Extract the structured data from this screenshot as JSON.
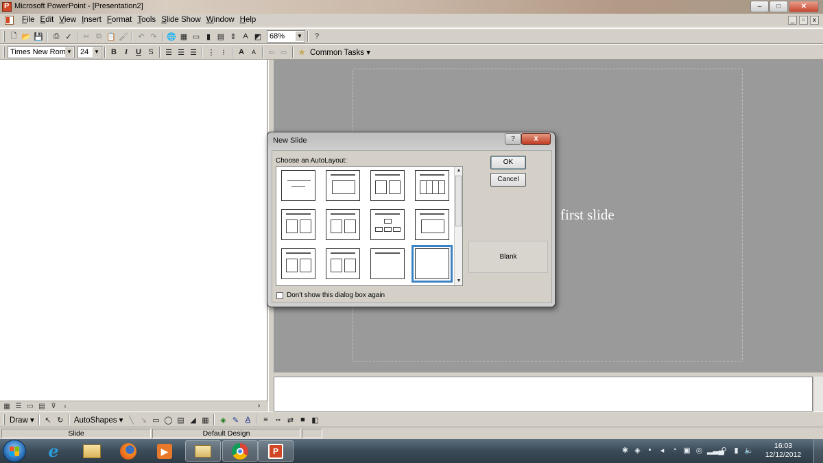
{
  "window": {
    "title": "Microsoft PowerPoint - [Presentation2]",
    "minimize": "–",
    "maximize": "□",
    "close": "✕"
  },
  "menu": {
    "items": [
      "File",
      "Edit",
      "View",
      "Insert",
      "Format",
      "Tools",
      "Slide Show",
      "Window",
      "Help"
    ],
    "mdi": [
      "_",
      "▫",
      "x"
    ]
  },
  "toolbar_standard": {
    "zoom": "68%",
    "help_icon": "?"
  },
  "toolbar_formatting": {
    "font": "Times New Roman",
    "size": "24",
    "bold": "B",
    "italic": "I",
    "underline": "U",
    "shadow": "S",
    "common_tasks": "Common Tasks"
  },
  "slide": {
    "visible_text": "first slide"
  },
  "dialog": {
    "title": "New Slide",
    "help": "?",
    "close": "x",
    "choose_label": "Choose an AutoLayout:",
    "ok": "OK",
    "cancel": "Cancel",
    "preview_label": "Blank",
    "checkbox_label": "Don't show this dialog box again"
  },
  "drawing_toolbar": {
    "draw": "Draw",
    "autoshapes": "AutoShapes"
  },
  "status": {
    "slide": "Slide",
    "design": "Default Design"
  },
  "taskbar": {
    "time": "16:03",
    "date": "12/12/2012"
  }
}
